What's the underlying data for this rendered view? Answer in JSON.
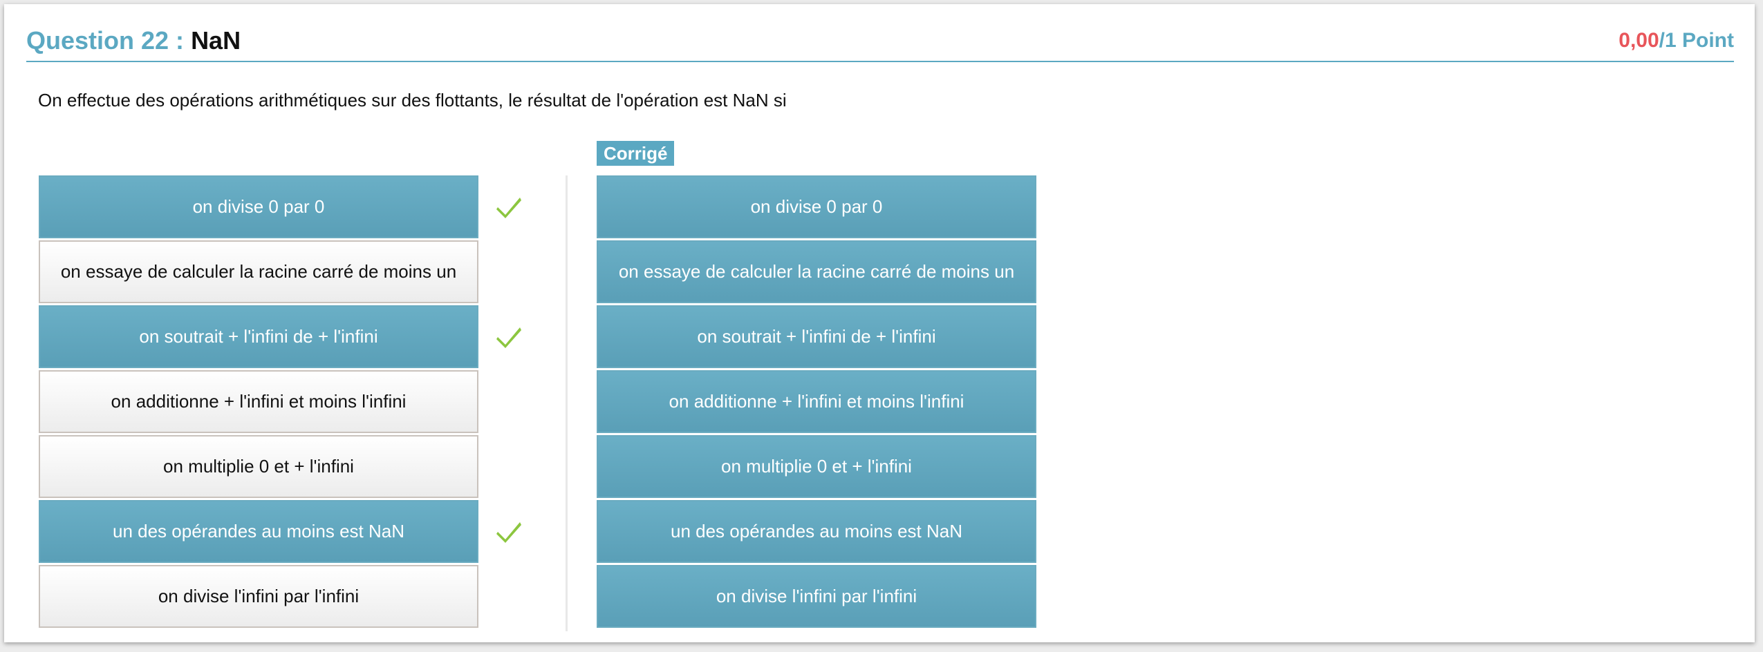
{
  "question": {
    "label": "Question 22 :",
    "subtitle": "NaN",
    "score_value": "0,00",
    "score_total": "/1 Point",
    "statement": "On effectue des opérations arithmétiques sur des flottants, le résultat de l'opération est NaN si"
  },
  "answers": [
    {
      "text": "on divise 0 par 0",
      "selected": true
    },
    {
      "text": "on essaye de calculer la racine carré de moins un",
      "selected": false
    },
    {
      "text": "on soutrait + l'infini de + l'infini",
      "selected": true
    },
    {
      "text": "on additionne + l'infini et moins l'infini",
      "selected": false
    },
    {
      "text": "on multiplie 0 et + l'infini",
      "selected": false
    },
    {
      "text": "un des opérandes au moins est NaN",
      "selected": true
    },
    {
      "text": "on divise l'infini par l'infini",
      "selected": false
    }
  ],
  "corrige": {
    "label": "Corrigé",
    "items": [
      "on divise 0 par 0",
      "on essaye de calculer la racine carré de moins un",
      "on soutrait + l'infini de + l'infini",
      "on additionne + l'infini et moins l'infini",
      "on multiplie 0 et + l'infini",
      "un des opérandes au moins est NaN",
      "on divise l'infini par l'infini"
    ]
  },
  "colors": {
    "accent": "#5ba8c2",
    "score_red": "#e8555a",
    "check_green": "#8cc63f"
  },
  "icons": {
    "check": "check-icon"
  }
}
